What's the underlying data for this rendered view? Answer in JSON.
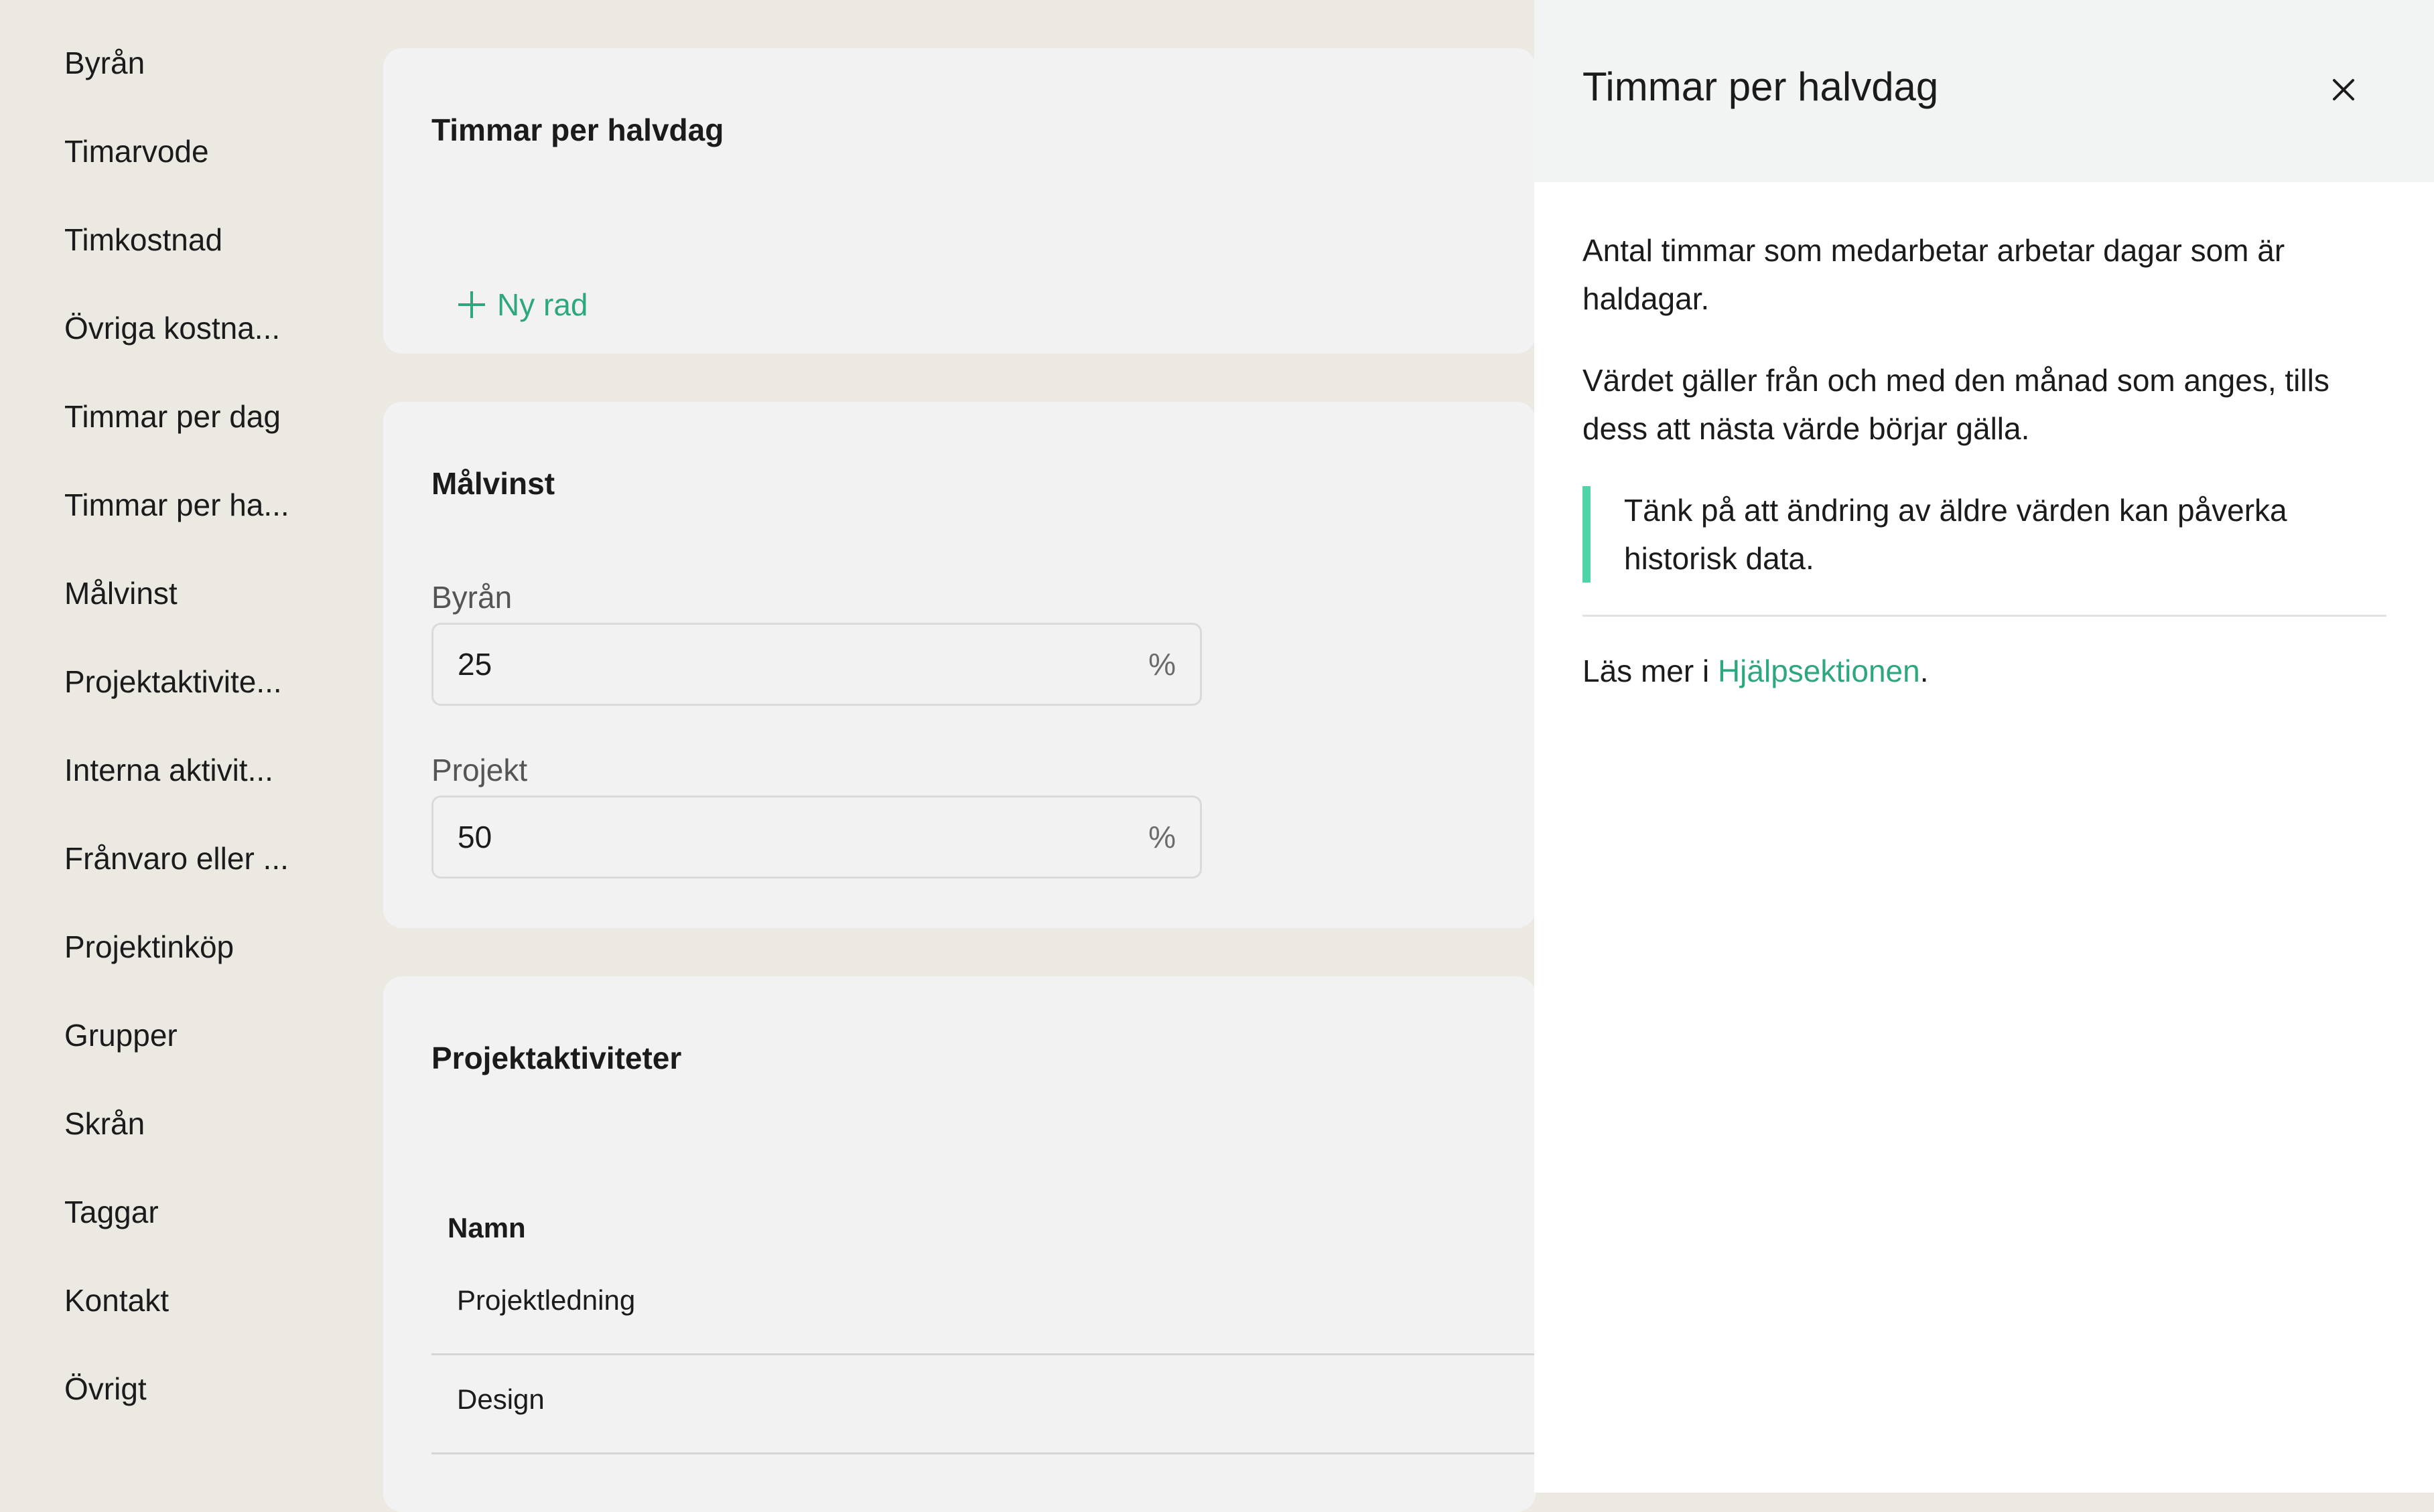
{
  "sidebar": {
    "items": [
      {
        "label": "Byrån"
      },
      {
        "label": "Timarvode"
      },
      {
        "label": "Timkostnad"
      },
      {
        "label": "Övriga kostna..."
      },
      {
        "label": "Timmar per dag"
      },
      {
        "label": "Timmar per ha..."
      },
      {
        "label": "Målvinst"
      },
      {
        "label": "Projektaktivite..."
      },
      {
        "label": "Interna aktivit..."
      },
      {
        "label": "Frånvaro eller ..."
      },
      {
        "label": "Projektinköp"
      },
      {
        "label": "Grupper"
      },
      {
        "label": "Skrån"
      },
      {
        "label": "Taggar"
      },
      {
        "label": "Kontakt"
      },
      {
        "label": "Övrigt"
      }
    ]
  },
  "main": {
    "halvdag_card": {
      "title": "Timmar per halvdag",
      "add_row_label": "Ny rad"
    },
    "malvinst_card": {
      "title": "Målvinst",
      "fields": [
        {
          "label": "Byrån",
          "value": "25",
          "suffix": "%"
        },
        {
          "label": "Projekt",
          "value": "50",
          "suffix": "%"
        }
      ]
    },
    "projektaktiviteter_card": {
      "title": "Projektaktiviteter",
      "column_header": "Namn",
      "rows": [
        {
          "name": "Projektledning"
        },
        {
          "name": "Design"
        }
      ]
    }
  },
  "panel": {
    "title": "Timmar per halvdag",
    "close_icon": "close-icon",
    "paragraph1": "Antal timmar som medarbetar arbetar dagar som är haldagar.",
    "paragraph2": "Värdet gäller från och med den månad som anges, tills dess att nästa värde börjar gälla.",
    "callout": "Tänk på att ändring av äldre värden kan påverka historisk data.",
    "readmore_prefix": "Läs mer i ",
    "readmore_link": "Hjälpsektionen",
    "readmore_suffix": "."
  },
  "colors": {
    "accent": "#2EA77F",
    "callout_bar": "#4FD4A6",
    "background": "#ECE9E2",
    "card": "#F2F2F2",
    "panel_header": "#F1F4F2"
  }
}
